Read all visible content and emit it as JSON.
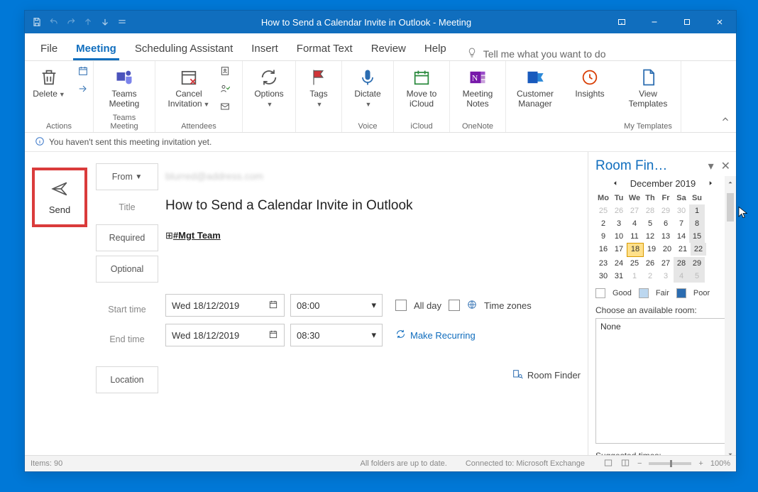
{
  "window": {
    "title": "How to Send a Calendar Invite in Outlook  -  Meeting"
  },
  "qat": {
    "save": "save-icon",
    "undo": "undo-icon",
    "redo": "redo-icon",
    "up": "up-icon",
    "down": "down-icon",
    "custom": "customize-icon"
  },
  "tabs": {
    "file": "File",
    "meeting": "Meeting",
    "scheduling": "Scheduling Assistant",
    "insert": "Insert",
    "format": "Format Text",
    "review": "Review",
    "help": "Help",
    "tellme": "Tell me what you want to do"
  },
  "ribbon": {
    "actions": {
      "delete": "Delete",
      "group": "Actions"
    },
    "teams": {
      "btn": "Teams\nMeeting",
      "group": "Teams Meeting"
    },
    "attendees": {
      "cancel": "Cancel\nInvitation",
      "group": "Attendees"
    },
    "options": {
      "btn": "Options"
    },
    "tags": {
      "btn": "Tags"
    },
    "voice": {
      "btn": "Dictate",
      "group": "Voice"
    },
    "icloud": {
      "btn": "Move to\niCloud",
      "group": "iCloud"
    },
    "onenote": {
      "btn": "Meeting\nNotes",
      "group": "OneNote"
    },
    "cm": {
      "btn": "Customer\nManager"
    },
    "insights": {
      "btn": "Insights"
    },
    "templates": {
      "btn": "View\nTemplates",
      "group": "My Templates"
    }
  },
  "infobar": {
    "msg": "You haven't sent this meeting invitation yet."
  },
  "compose": {
    "send": "Send",
    "fromLabel": "From",
    "fromValue": "blurred@address.com",
    "titleLabel": "Title",
    "titleValue": "How to Send a Calendar Invite in Outlook",
    "reqLabel": "Required",
    "reqValue": "#Mgt Team",
    "optLabel": "Optional",
    "startLabel": "Start time",
    "endLabel": "End time",
    "startDate": "Wed 18/12/2019",
    "startTime": "08:00",
    "endDate": "Wed 18/12/2019",
    "endTime": "08:30",
    "allDay": "All day",
    "timeZones": "Time zones",
    "recurring": "Make Recurring",
    "locLabel": "Location",
    "roomFinderBtn": "Room Finder"
  },
  "roomFinder": {
    "title": "Room Fin…",
    "month": "December 2019",
    "dow": [
      "Mo",
      "Tu",
      "We",
      "Th",
      "Fr",
      "Sa",
      "Su"
    ],
    "weeks": [
      [
        {
          "n": 25,
          "dim": true
        },
        {
          "n": 26,
          "dim": true
        },
        {
          "n": 27,
          "dim": true
        },
        {
          "n": 28,
          "dim": true
        },
        {
          "n": 29,
          "dim": true
        },
        {
          "n": 30,
          "dim": true
        },
        {
          "n": 1,
          "sel": true
        }
      ],
      [
        {
          "n": 2
        },
        {
          "n": 3
        },
        {
          "n": 4
        },
        {
          "n": 5
        },
        {
          "n": 6
        },
        {
          "n": 7
        },
        {
          "n": 8,
          "sel": true
        }
      ],
      [
        {
          "n": 9
        },
        {
          "n": 10
        },
        {
          "n": 11
        },
        {
          "n": 12
        },
        {
          "n": 13
        },
        {
          "n": 14
        },
        {
          "n": 15,
          "sel": true
        }
      ],
      [
        {
          "n": 16
        },
        {
          "n": 17
        },
        {
          "n": 18,
          "today": true
        },
        {
          "n": 19
        },
        {
          "n": 20
        },
        {
          "n": 21
        },
        {
          "n": 22,
          "sel": true
        }
      ],
      [
        {
          "n": 23
        },
        {
          "n": 24
        },
        {
          "n": 25
        },
        {
          "n": 26
        },
        {
          "n": 27
        },
        {
          "n": 28,
          "sel": true
        },
        {
          "n": 29,
          "sel": true
        }
      ],
      [
        {
          "n": 30
        },
        {
          "n": 31
        },
        {
          "n": 1,
          "dim": true
        },
        {
          "n": 2,
          "dim": true
        },
        {
          "n": 3,
          "dim": true
        },
        {
          "n": 4,
          "dim": true,
          "sel": true
        },
        {
          "n": 5,
          "dim": true,
          "sel": true
        }
      ]
    ],
    "legend": {
      "good": "Good",
      "fair": "Fair",
      "poor": "Poor"
    },
    "chooseLabel": "Choose an available room:",
    "available": "None",
    "suggested": "Suggested times:"
  },
  "status": {
    "items": "Items: 90",
    "folders": "All folders are up to date.",
    "conn": "Connected to: Microsoft Exchange",
    "zoom": "100%"
  }
}
